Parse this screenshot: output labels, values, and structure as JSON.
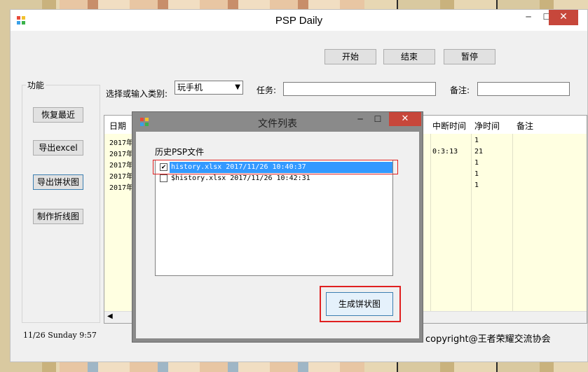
{
  "window": {
    "title": "PSP Daily",
    "minimize": "─",
    "maximize": "☐",
    "close": "✕"
  },
  "controls": {
    "start": "开始",
    "end": "结束",
    "pause": "暂停",
    "category_label": "选择或输入类别:",
    "category_value": "玩手机",
    "task_label": "任务:",
    "task_value": "",
    "note_label": "备注:",
    "note_value": ""
  },
  "functions": {
    "group_title": "功能",
    "restore": "恢复最近",
    "export_excel": "导出excel",
    "export_pie": "导出饼状图",
    "make_line": "制作折线图"
  },
  "grid": {
    "columns_left": [
      "日期"
    ],
    "columns_right": [
      "中断时间",
      "净时间",
      "备注"
    ],
    "rows": [
      {
        "date": "2017年",
        "interrupt": "",
        "net": "1"
      },
      {
        "date": "2017年",
        "interrupt": "0:3:13",
        "net": "21"
      },
      {
        "date": "2017年",
        "interrupt": "",
        "net": "1"
      },
      {
        "date": "2017年",
        "interrupt": "",
        "net": "1"
      },
      {
        "date": "2017年",
        "interrupt": "",
        "net": "1"
      }
    ]
  },
  "status": {
    "datetime": "11/26  Sunday 9:57",
    "copyright": "copyright@王者荣耀交流协会"
  },
  "dialog": {
    "title": "文件列表",
    "minimize": "─",
    "maximize": "☐",
    "close": "✕",
    "list_label": "历史PSP文件",
    "files": [
      {
        "name": "history.xlsx 2017/11/26 10:40:37",
        "checked": true
      },
      {
        "name": "$history.xlsx 2017/11/26 10:42:31",
        "checked": false
      }
    ],
    "generate_button": "生成饼状图"
  },
  "colors": {
    "close_red": "#c7473b",
    "highlight_red": "#e02020",
    "selection_blue": "#3399ff",
    "grid_yellow": "#ffffe1"
  }
}
